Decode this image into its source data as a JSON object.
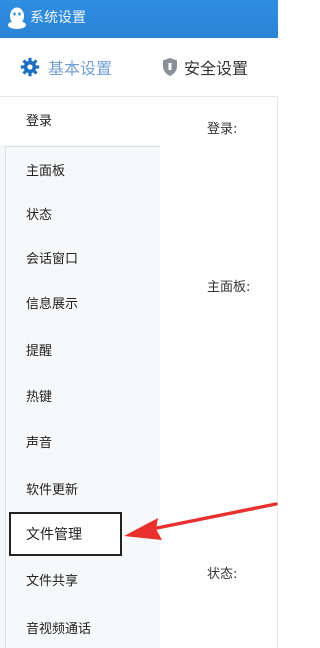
{
  "window": {
    "title": "系统设置"
  },
  "tabs": [
    {
      "label": "基本设置",
      "icon": "gear-icon",
      "active": true
    },
    {
      "label": "安全设置",
      "icon": "shield-icon",
      "active": false
    }
  ],
  "sidebar": {
    "items": [
      {
        "label": "登录"
      },
      {
        "label": "主面板"
      },
      {
        "label": "状态"
      },
      {
        "label": "会话窗口"
      },
      {
        "label": "信息展示"
      },
      {
        "label": "提醒"
      },
      {
        "label": "热键"
      },
      {
        "label": "声音"
      },
      {
        "label": "软件更新"
      },
      {
        "label": "文件管理",
        "highlighted": true
      },
      {
        "label": "文件共享"
      },
      {
        "label": "音视频通话"
      }
    ]
  },
  "content": {
    "sections": [
      {
        "label": "登录:"
      },
      {
        "label": "主面板:"
      },
      {
        "label": "状态:"
      }
    ]
  },
  "annotation": {
    "arrow_color": "#e8312f"
  },
  "colors": {
    "titlebar": "#2f8ee0",
    "accent": "#1d6fc4"
  }
}
